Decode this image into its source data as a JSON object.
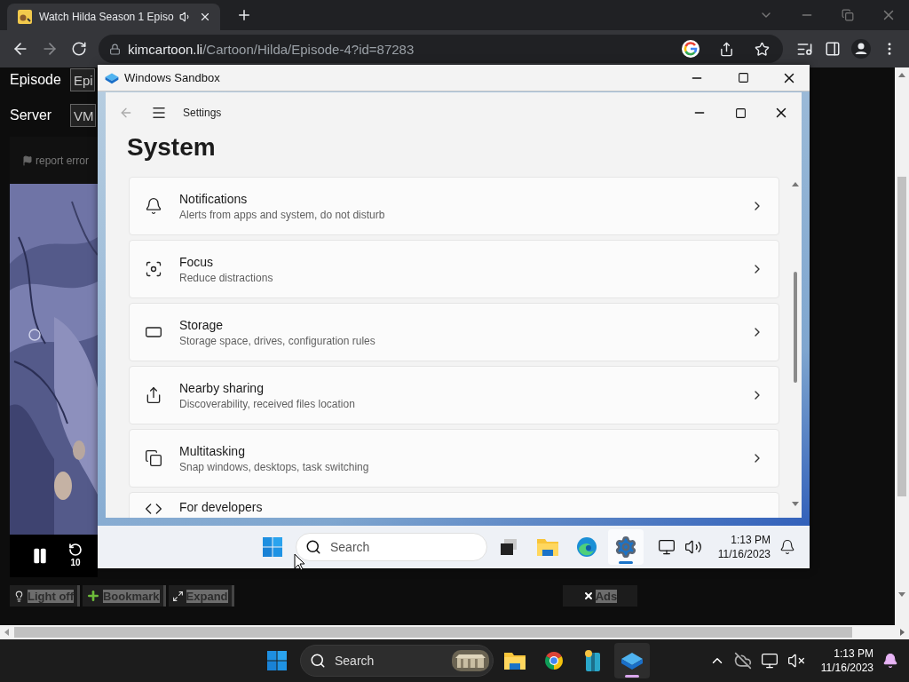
{
  "browser": {
    "tabs": [
      {
        "title": "Watch Hilda Season 1 Episo",
        "selected": true
      }
    ],
    "forward_disabled": true,
    "address": {
      "host": "kimcartoon.li",
      "path": "/Cartoon/Hilda/Episode-4?id=87283"
    }
  },
  "page": {
    "fields": [
      {
        "label": "Episode",
        "value": "Epi"
      },
      {
        "label": "Server",
        "value": "VM"
      }
    ],
    "report_link": "report error",
    "player": {
      "rewind_label": "10"
    },
    "actions": [
      {
        "label": "Light off",
        "kind": "bulb"
      },
      {
        "label": "Bookmark",
        "kind": "plus"
      },
      {
        "label": "Expand",
        "kind": "expand"
      }
    ],
    "ads_button": "Ads"
  },
  "sandbox": {
    "title": "Windows Sandbox",
    "settings": {
      "app_title": "Settings",
      "heading": "System",
      "items": [
        {
          "title": "Notifications",
          "subtitle": "Alerts from apps and system, do not disturb",
          "kind": "bell"
        },
        {
          "title": "Focus",
          "subtitle": "Reduce distractions",
          "kind": "focus"
        },
        {
          "title": "Storage",
          "subtitle": "Storage space, drives, configuration rules",
          "kind": "storage"
        },
        {
          "title": "Nearby sharing",
          "subtitle": "Discoverability, received files location",
          "kind": "share"
        },
        {
          "title": "Multitasking",
          "subtitle": "Snap windows, desktops, task switching",
          "kind": "multitask"
        },
        {
          "title": "For developers",
          "kind": "code"
        }
      ]
    },
    "taskbar": {
      "search": "Search",
      "apps": [
        {
          "kind": "taskview",
          "selected": false
        },
        {
          "kind": "explorer",
          "selected": false
        },
        {
          "kind": "edge",
          "selected": false
        },
        {
          "kind": "settings",
          "selected": true
        }
      ],
      "time": "1:13 PM",
      "date": "11/16/2023"
    }
  },
  "taskbar": {
    "search": "Search",
    "apps": [
      {
        "kind": "explorer",
        "selected": false
      },
      {
        "kind": "chrome",
        "selected": false
      },
      {
        "kind": "archive",
        "selected": false
      },
      {
        "kind": "sandbox",
        "selected": true
      }
    ],
    "time": "1:13 PM",
    "date": "11/16/2023"
  }
}
